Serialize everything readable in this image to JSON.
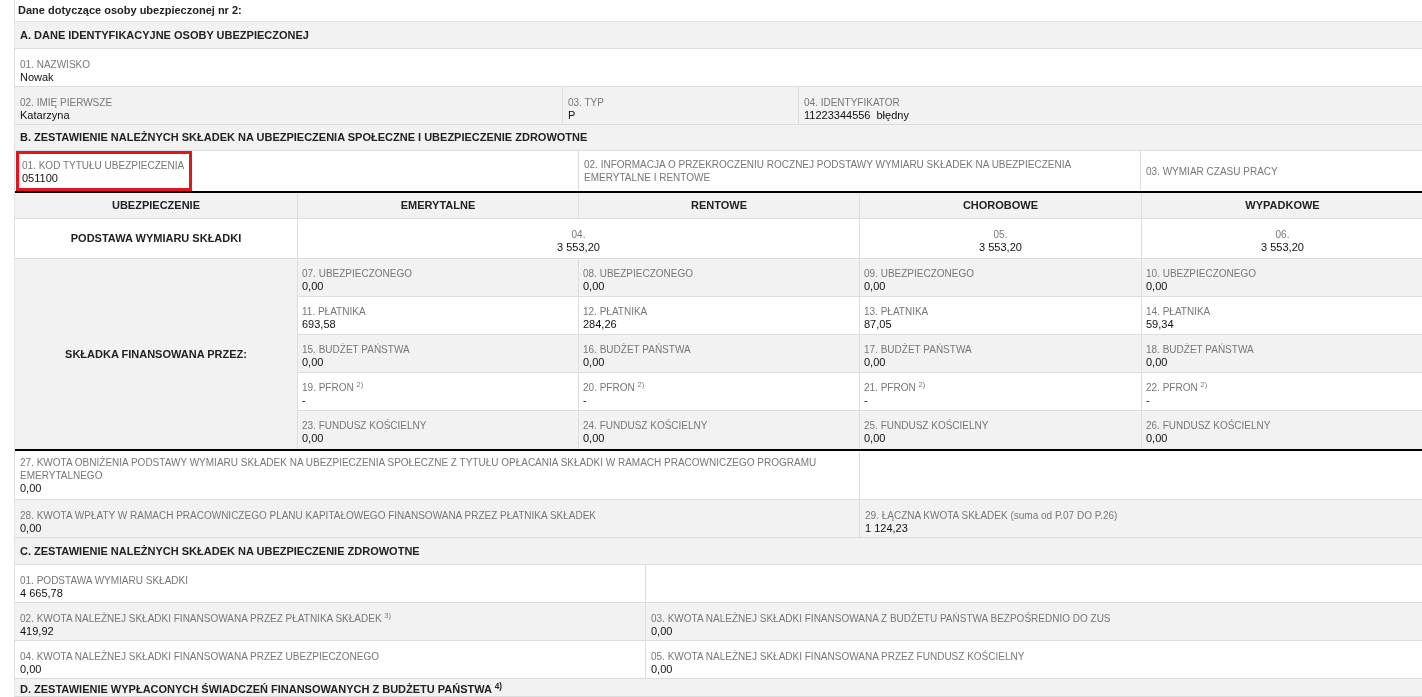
{
  "title": "Dane dotyczące osoby ubezpieczonej nr 2:",
  "section_a": {
    "heading": "A. DANE IDENTYFIKACYJNE OSOBY UBEZPIECZONEJ",
    "surname": {
      "label": "01. NAZWISKO",
      "value": "Nowak"
    },
    "first_name": {
      "label": "02. IMIĘ PIERWSZE",
      "value": "Katarzyna"
    },
    "type": {
      "label": "03. TYP",
      "value": "P"
    },
    "identifier": {
      "label": "04. IDENTYFIKATOR",
      "value": "11223344556",
      "status": "błędny"
    }
  },
  "section_b": {
    "heading": "B. ZESTAWIENIE NALEŻNYCH SKŁADEK NA UBEZPIECZENIA SPOŁECZNE I UBEZPIECZENIE ZDROWOTNE",
    "insurance_code": {
      "label": "01. KOD TYTUŁU UBEZPIECZENIA",
      "value": "051100",
      "highlighted": true
    },
    "threshold_info": {
      "label": "02. INFORMACJA O PRZEKROCZENIU ROCZNEJ PODSTAWY WYMIARU SKŁADEK NA UBEZPIECZENIA EMERYTALNE I RENTOWE"
    },
    "working_time": {
      "label": "03. WYMIAR CZASU PRACY"
    },
    "table": {
      "columns": [
        "UBEZPIECZENIE",
        "EMERYTALNE",
        "RENTOWE",
        "CHOROBOWE",
        "WYPADKOWE"
      ],
      "base_row": {
        "label": "PODSTAWA WYMIARU SKŁADKI",
        "cells": [
          {
            "label": "04.",
            "value": "3 553,20"
          },
          {
            "label": "05.",
            "value": "3 553,20"
          },
          {
            "label": "06.",
            "value": "3 553,20"
          }
        ]
      },
      "financed_row": {
        "label": "SKŁADKA FINANSOWANA PRZEZ:",
        "rows": [
          [
            {
              "label": "07. UBEZPIECZONEGO",
              "value": "0,00"
            },
            {
              "label": "08. UBEZPIECZONEGO",
              "value": "0,00"
            },
            {
              "label": "09. UBEZPIECZONEGO",
              "value": "0,00"
            },
            {
              "label": "10. UBEZPIECZONEGO",
              "value": "0,00"
            }
          ],
          [
            {
              "label": "11. PŁATNIKA",
              "value": "693,58"
            },
            {
              "label": "12. PŁATNIKA",
              "value": "284,26"
            },
            {
              "label": "13. PŁATNIKA",
              "value": "87,05"
            },
            {
              "label": "14. PŁATNIKA",
              "value": "59,34"
            }
          ],
          [
            {
              "label": "15. BUDŻET PAŃSTWA",
              "value": "0,00"
            },
            {
              "label": "16. BUDŻET PAŃSTWA",
              "value": "0,00"
            },
            {
              "label": "17. BUDŻET PAŃSTWA",
              "value": "0,00"
            },
            {
              "label": "18. BUDŻET PAŃSTWA",
              "value": "0,00"
            }
          ],
          [
            {
              "label": "19. PFRON $^{2)}$",
              "value": "-"
            },
            {
              "label": "20. PFRON $^{2)}$",
              "value": "-"
            },
            {
              "label": "21. PFRON $^{2)}$",
              "value": "-"
            },
            {
              "label": "22. PFRON $^{2)}$",
              "value": "-"
            }
          ],
          [
            {
              "label": "23. FUNDUSZ KOŚCIELNY",
              "value": "0,00"
            },
            {
              "label": "24. FUNDUSZ KOŚCIELNY",
              "value": "0,00"
            },
            {
              "label": "25. FUNDUSZ KOŚCIELNY",
              "value": "0,00"
            },
            {
              "label": "26. FUNDUSZ KOŚCIELNY",
              "value": "0,00"
            }
          ]
        ]
      }
    },
    "reduction": {
      "label": "27. KWOTA OBNIŻENIA PODSTAWY WYMIARU SKŁADEK NA UBEZPIECZENIA SPOŁECZNE Z TYTUŁU OPŁACANIA SKŁADKI W RAMACH PRACOWNICZEGO PROGRAMU EMERYTALNEGO",
      "value": "0,00"
    },
    "ppk": {
      "label": "28. KWOTA WPŁATY W RAMACH PRACOWNICZEGO PLANU KAPITAŁOWEGO FINANSOWANA PRZEZ PŁATNIKA SKŁADEK",
      "value": "0,00"
    },
    "total": {
      "label": "29. ŁĄCZNA KWOTA SKŁADEK (suma od P.07 DO P.26)",
      "value": "1 124,23"
    }
  },
  "section_c": {
    "heading": "C. ZESTAWIENIE NALEŻNYCH SKŁADEK NA UBEZPIECZENIE ZDROWOTNE",
    "fields": [
      {
        "label": "01. PODSTAWA WYMIARU SKŁADKI",
        "value": "4 665,78"
      },
      {
        "label": "02. KWOTA NALEŻNEJ SKŁADKI FINANSOWANA PRZEZ PŁATNIKA SKŁADEK $^{3)}$",
        "value": "419,92"
      },
      {
        "label": "03. KWOTA NALEŻNEJ SKŁADKI FINANSOWANA Z BUDŻETU PAŃSTWA BEZPOŚREDNIO DO ZUS",
        "value": "0,00"
      },
      {
        "label": "04. KWOTA NALEŻNEJ SKŁADKI FINANSOWANA PRZEZ UBEZPIECZONEGO",
        "value": "0,00"
      },
      {
        "label": "05. KWOTA NALEŻNEJ SKŁADKI FINANSOWANA PRZEZ FUNDUSZ KOŚCIELNY",
        "value": "0,00"
      }
    ]
  },
  "section_d": {
    "heading": "D. ZESTAWIENIE WYPŁACONYCH ŚWIADCZEŃ FINANSOWANYCH Z BUDŻETU PAŃSTWA $^{4)}$"
  }
}
